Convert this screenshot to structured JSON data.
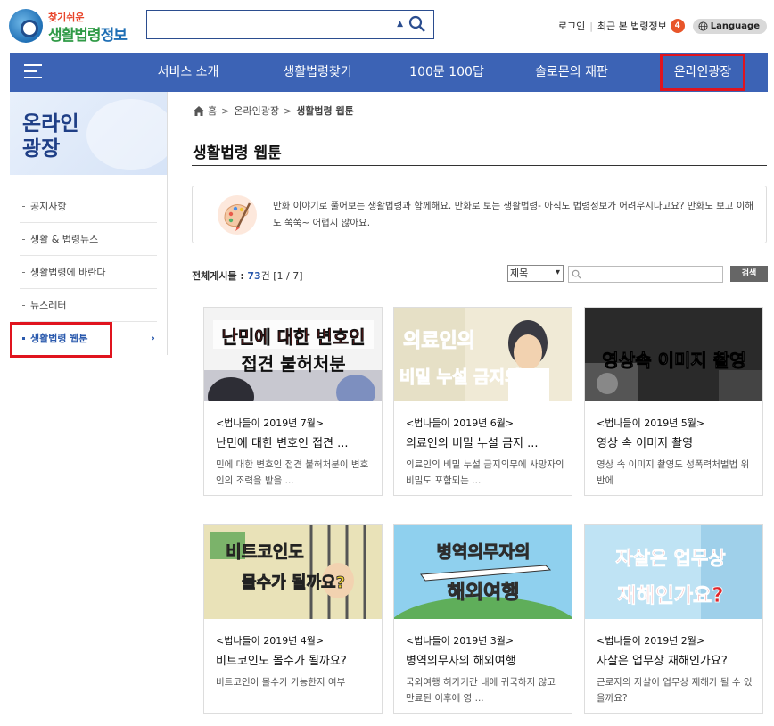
{
  "logo": {
    "line1": "찾기쉬운",
    "line2a": "생활법령",
    "line2b": "정보"
  },
  "search": {
    "value": "",
    "placeholder": ""
  },
  "topbar": {
    "login": "로그인",
    "recent": "최근 본 법령정보",
    "recent_count": "4",
    "language": "Language"
  },
  "nav": {
    "items": [
      "서비스 소개",
      "생활법령찾기",
      "100문 100답",
      "솔로몬의 재판",
      "온라인광장"
    ],
    "active_index": 4,
    "bg_color": "#3c63b5",
    "highlight_color": "#e0141e"
  },
  "sidebar": {
    "title": "온라인\n광장",
    "items": [
      "공지사항",
      "생활 & 법령뉴스",
      "생활법령에 바란다",
      "뉴스레터",
      "생활법령 웹툰"
    ],
    "active_index": 4,
    "active_chevron": "›"
  },
  "breadcrumb": {
    "items": [
      "홈",
      "온라인광장",
      "생활법령 웹툰"
    ],
    "separator": ">"
  },
  "page": {
    "title": "생활법령 웹툰"
  },
  "intro": {
    "text": "만화 이야기로 풀어보는 생활법령과 함께해요. 만화로 보는 생활법령- 아직도 법령정보가 어려우시다고요? 만화도 보고 이해도 쑥쑥~ 어렵지 않아요."
  },
  "list_info": {
    "label": "전체게시물 :",
    "count": "73",
    "unit": "건",
    "page": "[1 / 7]"
  },
  "filter": {
    "select_value": "제목",
    "input_value": "",
    "button": "검색"
  },
  "cards": [
    {
      "episode": "<법나들이 2019년 7월>",
      "title": "난민에 대한 변호인 접견 ...",
      "desc": "민에 대한 변호인 접견 불허처분이 변호인의 조력을 받을 ...",
      "img_text1": "난민에 대한 변호인",
      "img_text2": "접견 불허처분",
      "img_bg": "#f3f3f3",
      "img_color": "#e02020"
    },
    {
      "episode": "<법나들이 2019년 6월>",
      "title": "의료인의 비밀 누설 금지 ...",
      "desc": "의료인의 비밀 누설 금지의무에 사망자의 비밀도 포함되는 ...",
      "img_text1": "의료인의",
      "img_text2": "비밀 누설 금지의무",
      "img_bg": "#f0ead6",
      "img_color": "#3b7ad9"
    },
    {
      "episode": "<법나들이 2019년 5월>",
      "title": "영상 속 이미지 촬영",
      "desc": "영상 속 이미지 촬영도 성폭력처벌법 위반에",
      "img_text1": "영상속 이미지 촬영",
      "img_text2": "",
      "img_bg": "#2a2a2a",
      "img_color": "#ffffff"
    },
    {
      "episode": "<법나들이 2019년 4월>",
      "title": "비트코인도 몰수가 될까요?",
      "desc": "비트코인이 몰수가 가능한지 여부",
      "img_text1": "비트코인도",
      "img_text2": "몰수가 될까요?",
      "img_bg": "#e9e2b8",
      "img_color": "#f0d230"
    },
    {
      "episode": "<법나들이 2019년 3월>",
      "title": "병역의무자의 해외여행",
      "desc": "국외여행 허가기간 내에 귀국하지 않고 만료된 이후에 영 ...",
      "img_text1": "병역의무자의",
      "img_text2": "해외여행",
      "img_bg": "#8fd0ee",
      "img_color": "#f3c52b"
    },
    {
      "episode": "<법나들이 2019년 2월>",
      "title": "자살은 업무상 재해인가요?",
      "desc": "근로자의 자살이 업무상 재해가 될 수 있을까요?",
      "img_text1": "자살은 업무상",
      "img_text2": "재해인가요?",
      "img_bg": "#bfe3f4",
      "img_color": "#e0262a"
    }
  ]
}
